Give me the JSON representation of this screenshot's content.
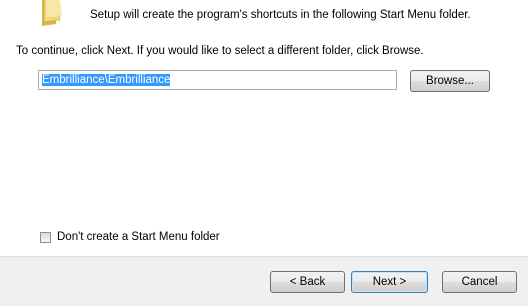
{
  "header": {
    "intro_text": "Setup will create the program's shortcuts in the following Start Menu folder.",
    "folder_icon": "folder-icon"
  },
  "main": {
    "instruction_text": "To continue, click Next. If you would like to select a different folder, click Browse.",
    "folder_value": "Embrilliance\\Embrilliance",
    "browse_label": "Browse...",
    "checkbox_label": "Don't create a Start Menu folder",
    "checkbox_checked": false
  },
  "footer": {
    "back_label": "< Back",
    "next_label": "Next >",
    "cancel_label": "Cancel"
  }
}
